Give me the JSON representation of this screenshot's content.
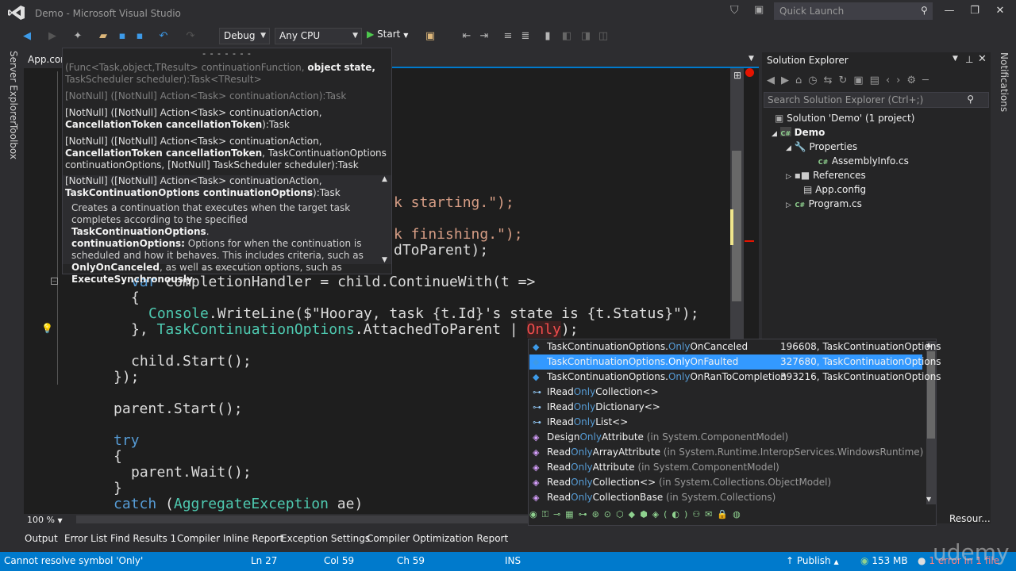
{
  "window": {
    "title": "Demo - Microsoft Visual Studio",
    "quick_launch_placeholder": "Quick Launch"
  },
  "toolbar": {
    "config": "Debug",
    "platform": "Any CPU",
    "start_label": "Start"
  },
  "side_tabs": [
    "Server Explorer",
    "Toolbox"
  ],
  "right_tabs": [
    "Notifications"
  ],
  "doc_tab": "App.config",
  "signature_help": {
    "dashes_top": "- - - - - - -",
    "dashes_bottom": "- - - - - - -",
    "overload1_a": "(Func<Task,object,TResult> continuationFunction, ",
    "overload1_b": "object state,",
    "overload1_c": "TaskScheduler scheduler):Task<TResult>",
    "overload2": "[NotNull] ([NotNull] Action<Task> continuationAction):Task",
    "overload3_a": "[NotNull] ([NotNull] Action<Task> continuationAction, ",
    "overload3_b": "CancellationToken cancellationToken",
    "overload3_c": "):Task",
    "overload4_a": "[NotNull] ([NotNull] Action<Task> continuationAction, ",
    "overload4_b": "CancellationToken cancellationToken",
    "overload4_c": ", TaskContinuationOptions continuationOptions, [NotNull] TaskScheduler scheduler):Task",
    "overload5_a": "[NotNull] ([NotNull] Action<Task> continuationAction,",
    "overload5_b": "TaskContinuationOptions continuationOptions",
    "overload5_c": "):Task",
    "desc_1": "Creates a continuation that executes when the target task completes according to the specified ",
    "desc_1b": "TaskContinuationOptions",
    "desc_1c": ".",
    "desc_2a": "continuationOptions:",
    "desc_2b": " Options for when the continuation is scheduled and how it behaves. This includes criteria, such as ",
    "desc_2c": "OnlyOnCanceled",
    "desc_2d": ", as well as execution options, such as ",
    "desc_2e": "ExecuteSynchronously",
    "desc_2f": "."
  },
  "code": {
    "l1a": "k starting.\");",
    "l2a": "k finishing.\");",
    "l3a": "dToParent);",
    "l4_var": "var",
    "l4_rest": " completionHandler = child.ContinueWith(t =>",
    "l5": "{",
    "l6_cls": "Console",
    "l6_rest": ".WriteLine($\"Hooray, task {t.Id}'s state is {t.Status}\");",
    "l7_a": "}, ",
    "l7_enum": "TaskContinuationOptions",
    "l7_b": ".AttachedToParent | ",
    "l7_only": "Only",
    "l7_c": ");",
    "l8": "child.Start();",
    "l9": "});",
    "l10": "parent.Start();",
    "l11": "try",
    "l12": "{",
    "l13": "parent.Wait();",
    "l14": "}",
    "l15_kw": "catch",
    "l15_a": " (",
    "l15_ty": "AggregateException",
    "l15_b": " ae)"
  },
  "zoom": "100 %",
  "autocomplete": {
    "items": [
      {
        "pre": "TaskContinuationOptions.",
        "hl": "Only",
        "post": "OnCanceled",
        "rt": "196608, TaskContinuationOptions",
        "ns": "",
        "icon": "enum-member-icon"
      },
      {
        "pre": "TaskContinuationOptions.",
        "hl": "Only",
        "post": "OnFaulted",
        "rt": "327680, TaskContinuationOptions",
        "ns": "",
        "icon": "enum-member-icon"
      },
      {
        "pre": "TaskContinuationOptions.",
        "hl": "Only",
        "post": "OnRanToCompletion",
        "rt": "393216, TaskContinuationOptions",
        "ns": "",
        "icon": "enum-member-icon"
      },
      {
        "pre": "IRead",
        "hl": "Only",
        "post": "Collection<>",
        "rt": "",
        "ns": "",
        "icon": "interface-icon"
      },
      {
        "pre": "IRead",
        "hl": "Only",
        "post": "Dictionary<>",
        "rt": "",
        "ns": "",
        "icon": "interface-icon"
      },
      {
        "pre": "IRead",
        "hl": "Only",
        "post": "List<>",
        "rt": "",
        "ns": "",
        "icon": "interface-icon"
      },
      {
        "pre": "Design",
        "hl": "Only",
        "post": "Attribute",
        "rt": "",
        "ns": " (in System.ComponentModel)",
        "icon": "class-icon"
      },
      {
        "pre": "Read",
        "hl": "Only",
        "post": "ArrayAttribute",
        "rt": "",
        "ns": " (in System.Runtime.InteropServices.WindowsRuntime)",
        "icon": "class-icon"
      },
      {
        "pre": "Read",
        "hl": "Only",
        "post": "Attribute",
        "rt": "",
        "ns": " (in System.ComponentModel)",
        "icon": "class-icon"
      },
      {
        "pre": "Read",
        "hl": "Only",
        "post": "Collection<>",
        "rt": "",
        "ns": " (in System.Collections.ObjectModel)",
        "icon": "class-icon"
      },
      {
        "pre": "Read",
        "hl": "Only",
        "post": "CollectionBase",
        "rt": "",
        "ns": " (in System.Collections)",
        "icon": "class-icon"
      }
    ],
    "selected_index": 1
  },
  "solution_explorer": {
    "title": "Solution Explorer",
    "search_placeholder": "Search Solution Explorer (Ctrl+;)",
    "solution": "Solution 'Demo' (1 project)",
    "project": "Demo",
    "properties": "Properties",
    "assemblyinfo": "AssemblyInfo.cs",
    "references": "References",
    "appconfig": "App.config",
    "program": "Program.cs",
    "resources_tab": "Resour..."
  },
  "bottom_tabs": [
    "Output",
    "Error List",
    "Find Results 1",
    "Compiler Inline Report",
    "Exception Settings",
    "Compiler Optimization Report"
  ],
  "status": {
    "message": "Cannot resolve symbol 'Only'",
    "ln": "Ln 27",
    "col": "Col 59",
    "ch": "Ch 59",
    "ins": "INS",
    "publish": "Publish",
    "memory": "153 MB",
    "errors": "1 error in 1 file"
  },
  "watermark": "udemy",
  "colors": {
    "accent": "#007acc",
    "selection": "#3399ff",
    "keyword": "#569cd6",
    "type": "#4ec9b0",
    "string": "#d69d85"
  }
}
